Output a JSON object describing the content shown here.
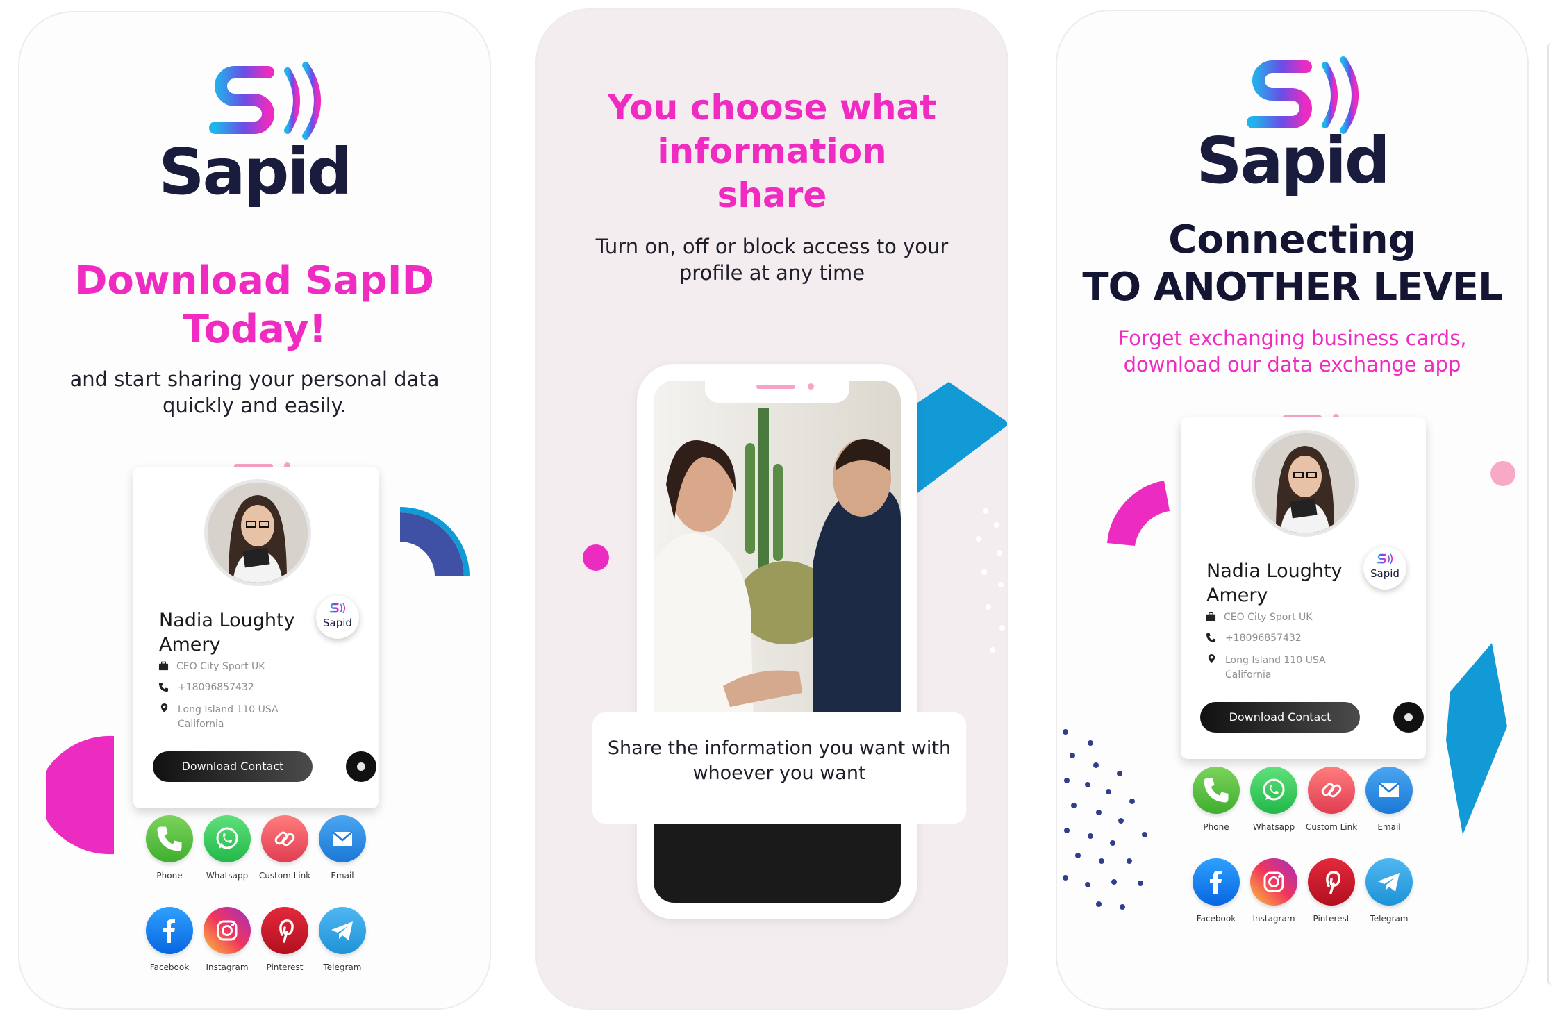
{
  "screen1": {
    "logo_text": "Sapid",
    "headline_1": "Download SapID",
    "headline_2": "Today!",
    "subtext_1": "and start sharing your personal data",
    "subtext_2": "quickly and easily."
  },
  "screen2": {
    "headline_1": "You choose what",
    "headline_2": "information",
    "headline_3": "share",
    "subtext_1": "Turn on, off or block access to your",
    "subtext_2": "profile at any time",
    "caption_1": "Share the information you want with",
    "caption_2": "whoever you want"
  },
  "screen3": {
    "logo_text": "Sapid",
    "headline_1": "Connecting",
    "headline_2": "TO ANOTHER LEVEL",
    "subtext_1": "Forget exchanging business cards,",
    "subtext_2": "download our data exchange app"
  },
  "profile": {
    "name_line1": "Nadia Loughty",
    "name_line2": "Amery",
    "badge_text": "Sapid",
    "job": "CEO City Sport UK",
    "phone": "+18096857432",
    "address_line1": "Long Island 110 USA",
    "address_line2": "California",
    "download_label": "Download Contact"
  },
  "social": {
    "phone": "Phone",
    "whatsapp": "Whatsapp",
    "custom_link": "Custom Link",
    "email": "Email",
    "facebook": "Facebook",
    "instagram": "Instagram",
    "pinterest": "Pinterest",
    "telegram": "Telegram"
  },
  "colors": {
    "pink": "#ef2bc1",
    "navy": "#141533",
    "blue_accent": "#129ad7",
    "logo_gradient": [
      "#1fb5ec",
      "#6b4de6",
      "#ec2cc0"
    ]
  }
}
